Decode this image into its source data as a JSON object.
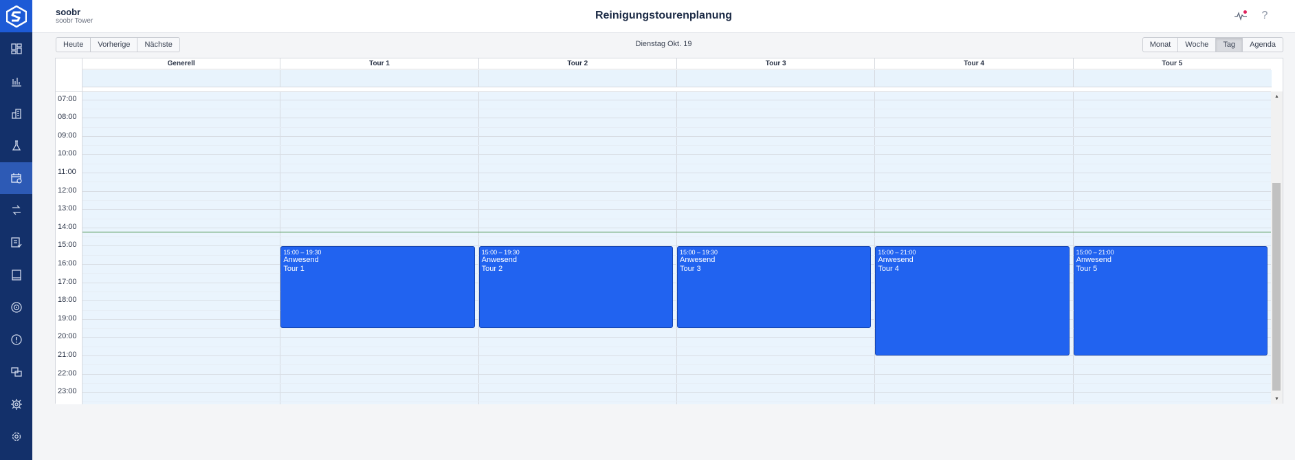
{
  "header": {
    "site_name": "soobr",
    "site_sub": "soobr Tower",
    "page_title": "Reinigungstourenplanung",
    "help_label": "?"
  },
  "toolbar": {
    "nav_buttons": [
      "Heute",
      "Vorherige",
      "Nächste"
    ],
    "date_label": "Dienstag Okt. 19",
    "view_buttons": [
      "Monat",
      "Woche",
      "Tag",
      "Agenda"
    ],
    "active_view": "Tag"
  },
  "sidebar": {
    "items": [
      {
        "icon": "dashboard-icon"
      },
      {
        "icon": "bar-chart-icon"
      },
      {
        "icon": "building-icon"
      },
      {
        "icon": "lab-flask-icon"
      },
      {
        "icon": "calendar-icon",
        "active": true
      },
      {
        "icon": "swap-icon"
      },
      {
        "icon": "checklist-icon"
      },
      {
        "icon": "book-icon"
      },
      {
        "icon": "target-icon"
      },
      {
        "icon": "alert-icon"
      },
      {
        "icon": "people-icon"
      },
      {
        "icon": "cog-group-icon"
      },
      {
        "icon": "settings-icon"
      }
    ]
  },
  "calendar": {
    "columns": [
      "Generell",
      "Tour 1",
      "Tour 2",
      "Tour 3",
      "Tour 4",
      "Tour 5"
    ],
    "time_labels": [
      "07:00",
      "08:00",
      "09:00",
      "10:00",
      "11:00",
      "12:00",
      "13:00",
      "14:00",
      "15:00",
      "16:00",
      "17:00",
      "18:00",
      "19:00",
      "20:00",
      "21:00",
      "22:00",
      "23:00"
    ],
    "now_time": "14:15",
    "events": [
      {
        "column": 1,
        "time": "15:00 – 19:30",
        "title": "Anwesend",
        "tour": "Tour 1",
        "start": 15,
        "end": 19.5
      },
      {
        "column": 2,
        "time": "15:00 – 19:30",
        "title": "Anwesend",
        "tour": "Tour 2",
        "start": 15,
        "end": 19.5
      },
      {
        "column": 3,
        "time": "15:00 – 19:30",
        "title": "Anwesend",
        "tour": "Tour 3",
        "start": 15,
        "end": 19.5
      },
      {
        "column": 4,
        "time": "15:00 – 21:00",
        "title": "Anwesend",
        "tour": "Tour 4",
        "start": 15,
        "end": 21
      },
      {
        "column": 5,
        "time": "15:00 – 21:00",
        "title": "Anwesend",
        "tour": "Tour 5",
        "start": 15,
        "end": 21
      }
    ]
  },
  "colors": {
    "sidebar": "#13306a",
    "accent": "#1d5ad6",
    "event": "#2163f0",
    "now_line": "#3d8c40"
  }
}
